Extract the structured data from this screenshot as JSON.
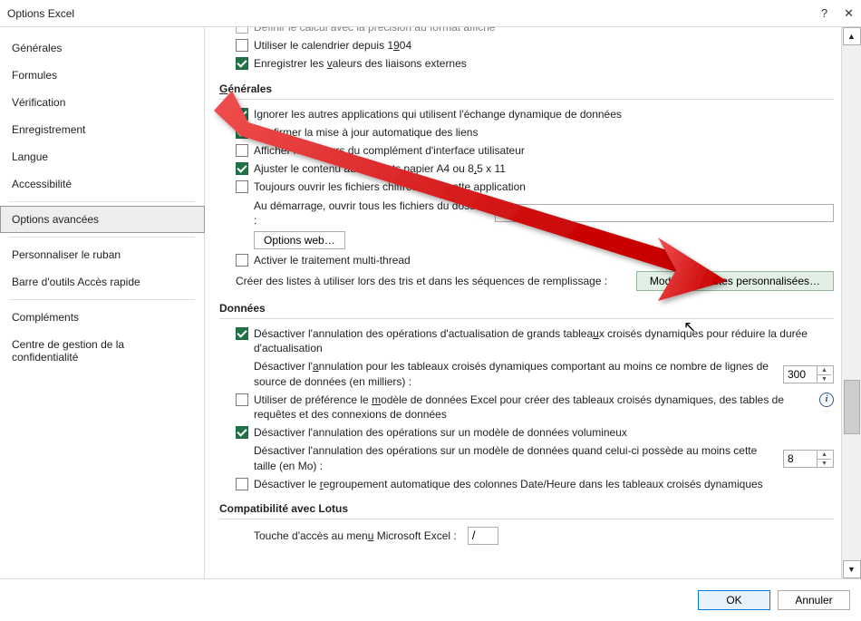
{
  "window": {
    "title": "Options Excel",
    "help_icon": "?",
    "close_icon": "✕"
  },
  "sidebar": {
    "items": [
      {
        "label": "Générales"
      },
      {
        "label": "Formules"
      },
      {
        "label": "Vérification"
      },
      {
        "label": "Enregistrement"
      },
      {
        "label": "Langue"
      },
      {
        "label": "Accessibilité"
      },
      {
        "label": "Options avancées",
        "active": true
      },
      {
        "label": "Personnaliser le ruban"
      },
      {
        "label": "Barre d'outils Accès rapide"
      },
      {
        "label": "Compléments"
      },
      {
        "label": "Centre de gestion de la confidentialité"
      }
    ]
  },
  "top_checks": {
    "c0": "Définir le calcul avec la précision au format affiché",
    "c1": "Utiliser le calendrier depuis 1904",
    "c2": "Enregistrer les valeurs des liaisons externes"
  },
  "generales": {
    "title": "Générales",
    "ignore_apps": "Ignorer les autres applications qui utilisent l'échange dynamique de données",
    "confirm_update": "Confirmer la mise à jour automatique des liens",
    "show_addon_errors": "Afficher les erreurs du complément d'interface utilisateur",
    "adjust_a4": "Ajuster le contenu aux formats papier A4 ou 8,5 x 11",
    "open_encrypted": "Toujours ouvrir les fichiers chiffrés dans cette application",
    "startup_open_label": "Au démarrage, ouvrir tous les fichiers du dossier :",
    "startup_value": "",
    "web_options_btn": "Options web…",
    "multithread": "Activer le traitement multi-thread",
    "custom_lists_label": "Créer des listes à utiliser lors des tris et dans les séquences de remplissage :",
    "custom_lists_btn": "Modifier les listes personnalisées…"
  },
  "donnees": {
    "title": "Données",
    "disable_undo_pivot": "Désactiver l'annulation des opérations d'actualisation de grands tableaux croisés dynamiques pour réduire la durée d'actualisation",
    "disable_undo_threshold_label": "Désactiver l'annulation pour les tableaux croisés dynamiques comportant au moins ce nombre de lignes de source de données (en milliers) :",
    "disable_undo_threshold_value": "300",
    "prefer_datamodel": "Utiliser de préférence le modèle de données Excel pour créer des tableaux croisés dynamiques, des tables de requêtes et des connexions de données",
    "disable_undo_large_model": "Désactiver l'annulation des opérations sur un modèle de données volumineux",
    "disable_undo_size_label": "Désactiver l'annulation des opérations sur un modèle de données quand celui-ci possède au moins cette taille (en Mo) :",
    "disable_undo_size_value": "8",
    "disable_auto_group": "Désactiver le regroupement automatique des colonnes Date/Heure dans les tableaux croisés dynamiques"
  },
  "lotus": {
    "title": "Compatibilité avec Lotus",
    "menu_key_label": "Touche d'accès au menu Microsoft Excel :",
    "menu_key_value": "/"
  },
  "footer": {
    "ok": "OK",
    "cancel": "Annuler"
  }
}
